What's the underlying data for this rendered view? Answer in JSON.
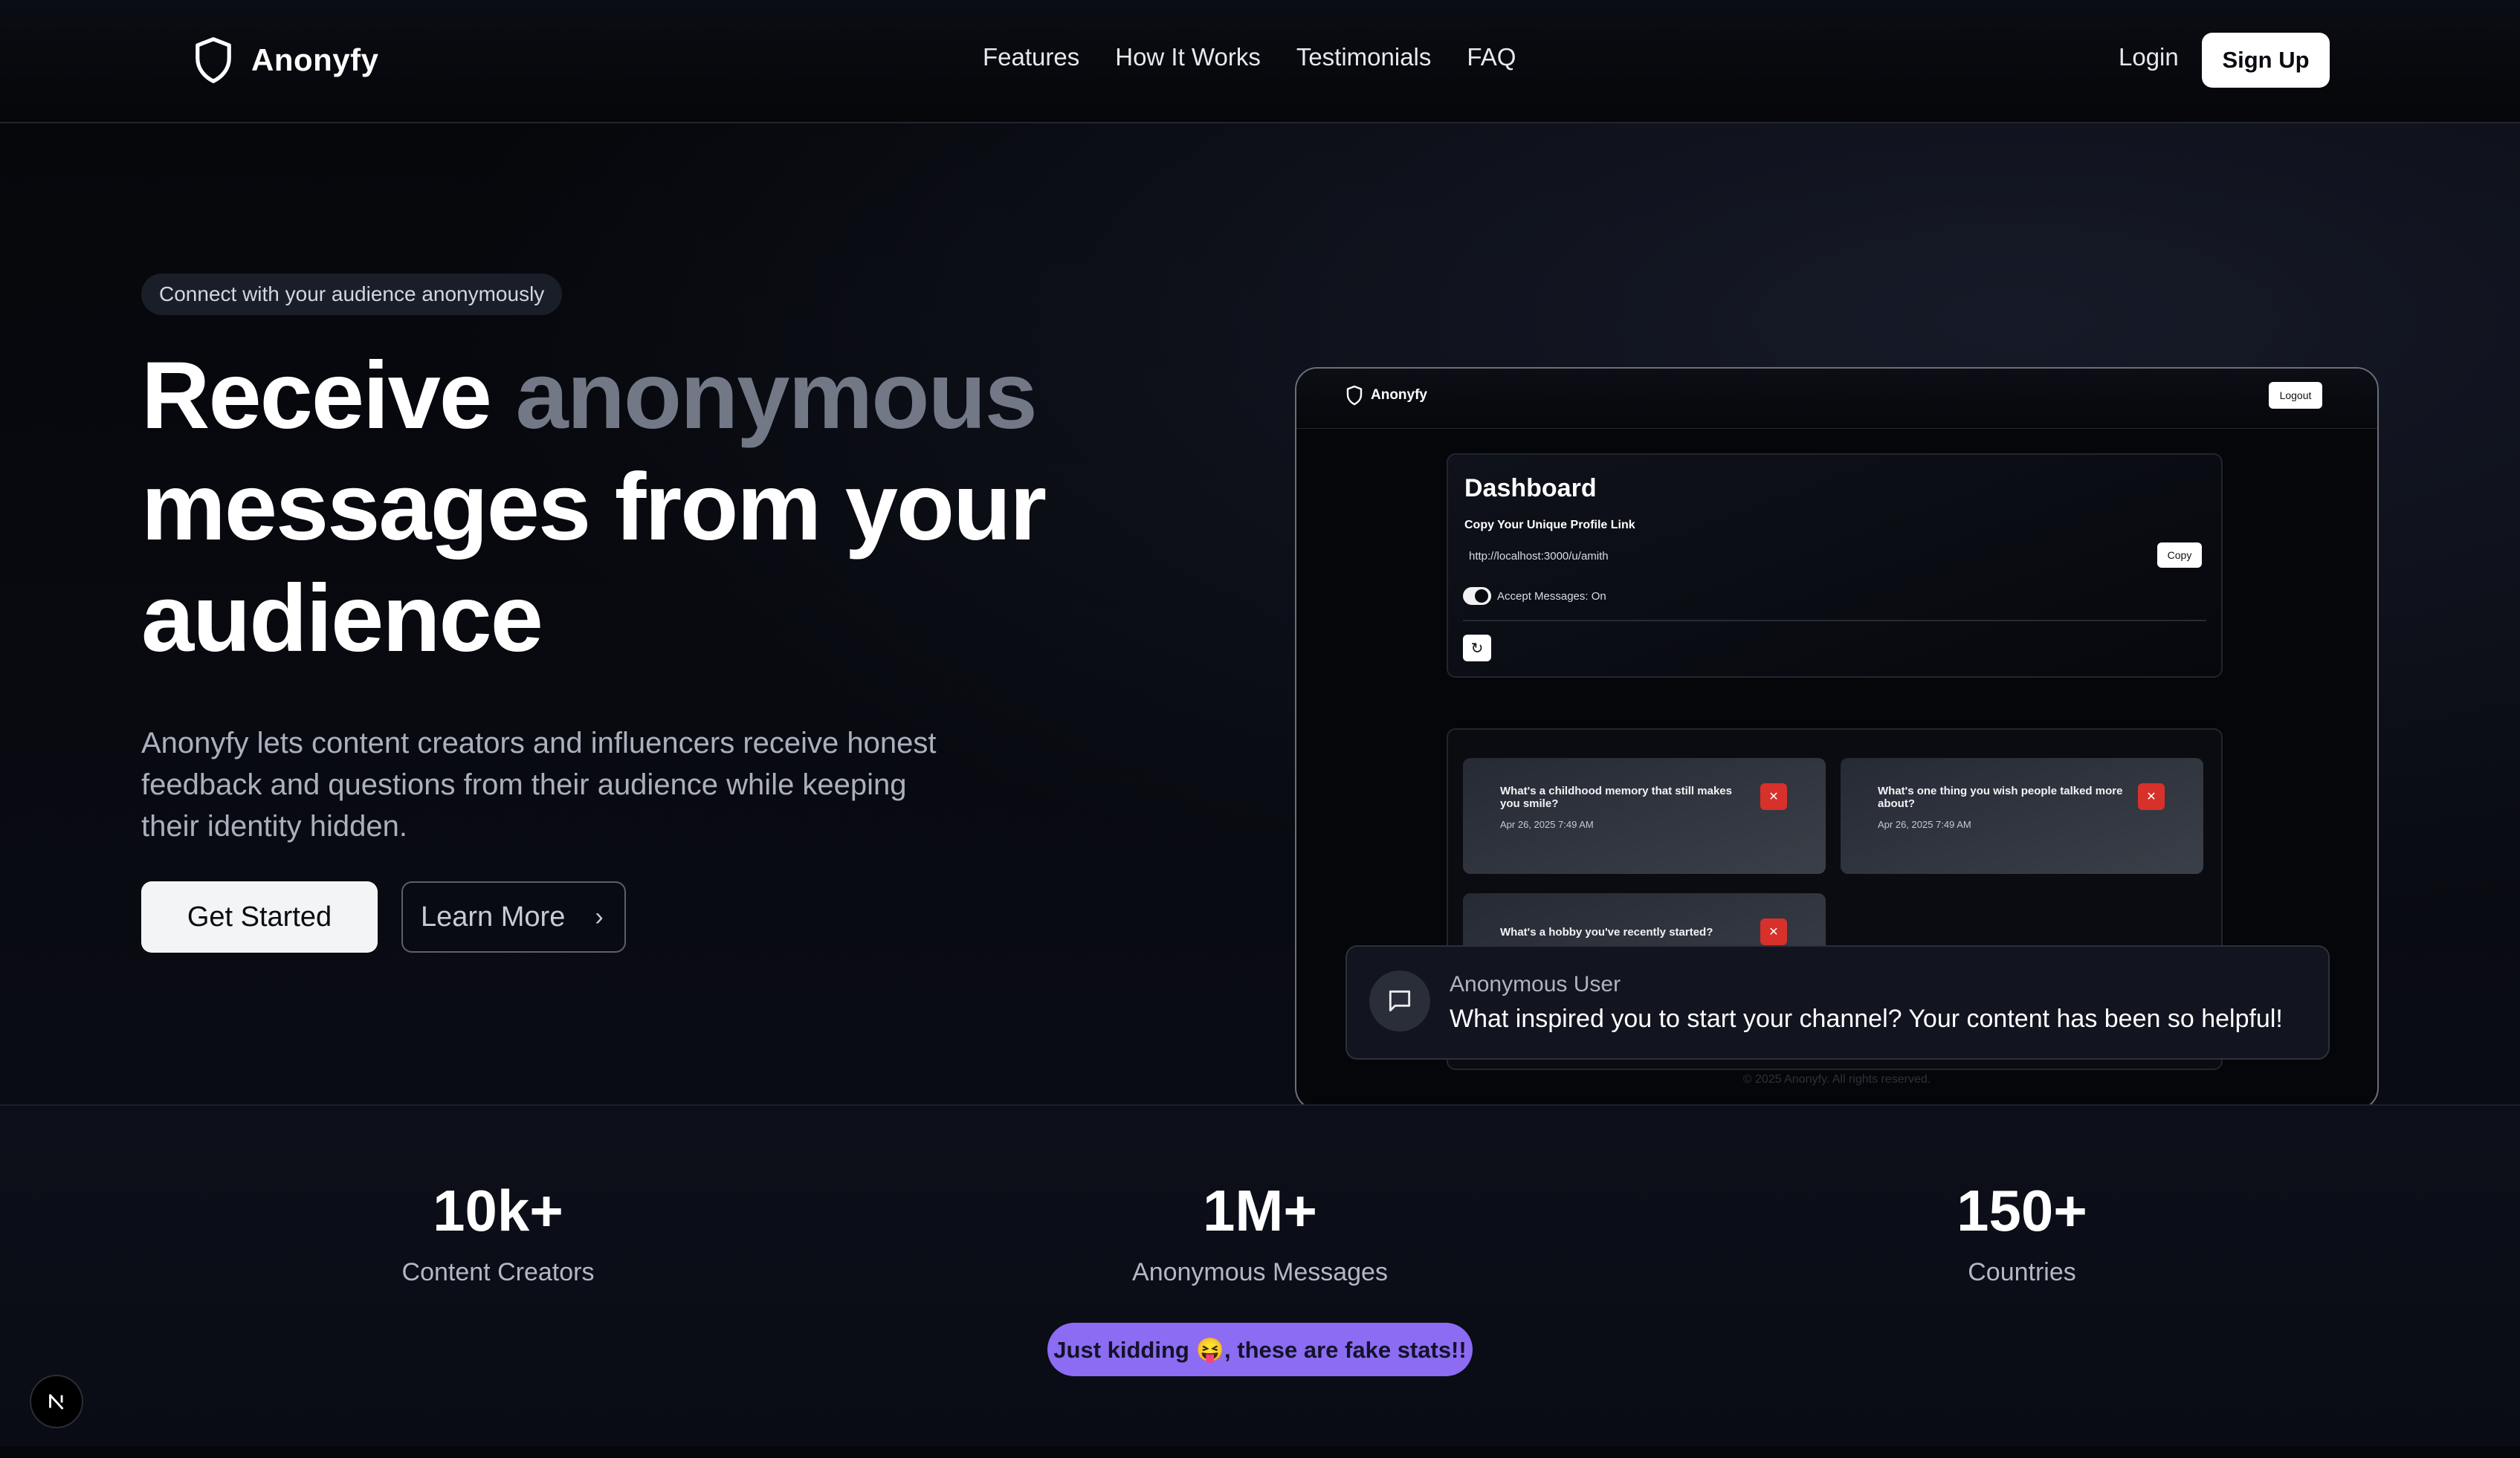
{
  "nav": {
    "brand": "Anonyfy",
    "links": [
      "Features",
      "How It Works",
      "Testimonials",
      "FAQ"
    ],
    "login": "Login",
    "signup": "Sign Up"
  },
  "hero": {
    "pill": "Connect with your audience anonymously",
    "headline_part1": "Receive ",
    "headline_accent": "anonymous",
    "headline_part2": "messages from your audience",
    "lead": "Anonyfy lets content creators and influencers receive honest feedback and questions from their audience while keeping their identity hidden.",
    "primary_cta": "Get Started",
    "secondary_cta": "Learn More"
  },
  "preview": {
    "brand": "Anonyfy",
    "logout": "Logout",
    "dashboard_title": "Dashboard",
    "copy_label": "Copy Your Unique Profile Link",
    "profile_url": "http://localhost:3000/u/amith",
    "copy_button": "Copy",
    "accept_label": "Accept Messages: On",
    "messages": [
      {
        "question": "What's a childhood memory that still makes you smile?",
        "date": "Apr 26, 2025 7:49 AM"
      },
      {
        "question": "What's one thing you wish people talked more about?",
        "date": "Apr 26, 2025 7:49 AM"
      },
      {
        "question": "What's a hobby you've recently started?",
        "date": ""
      }
    ],
    "toast": {
      "sender": "Anonymous User",
      "message": "What inspired you to start your channel? Your content has been so helpful!"
    },
    "footer": "© 2025 Anonyfy. All rights reserved."
  },
  "stats": {
    "items": [
      {
        "value": "10k+",
        "label": "Content Creators"
      },
      {
        "value": "1M+",
        "label": "Anonymous Messages"
      },
      {
        "value": "150+",
        "label": "Countries"
      }
    ],
    "disclaimer": "Just kidding 😝, these are fake stats!!"
  },
  "icons": {
    "brand_logo": "shield-icon",
    "chevron": "chevron-right-icon",
    "toast_avatar": "message-square-icon",
    "delete": "close-icon",
    "refresh": "refresh-icon",
    "dev_badge": "nextjs-icon"
  },
  "colors": {
    "accent_muted": "#737887",
    "disclaimer_bg": "#8b6cf2",
    "delete_red": "#d8302a"
  }
}
